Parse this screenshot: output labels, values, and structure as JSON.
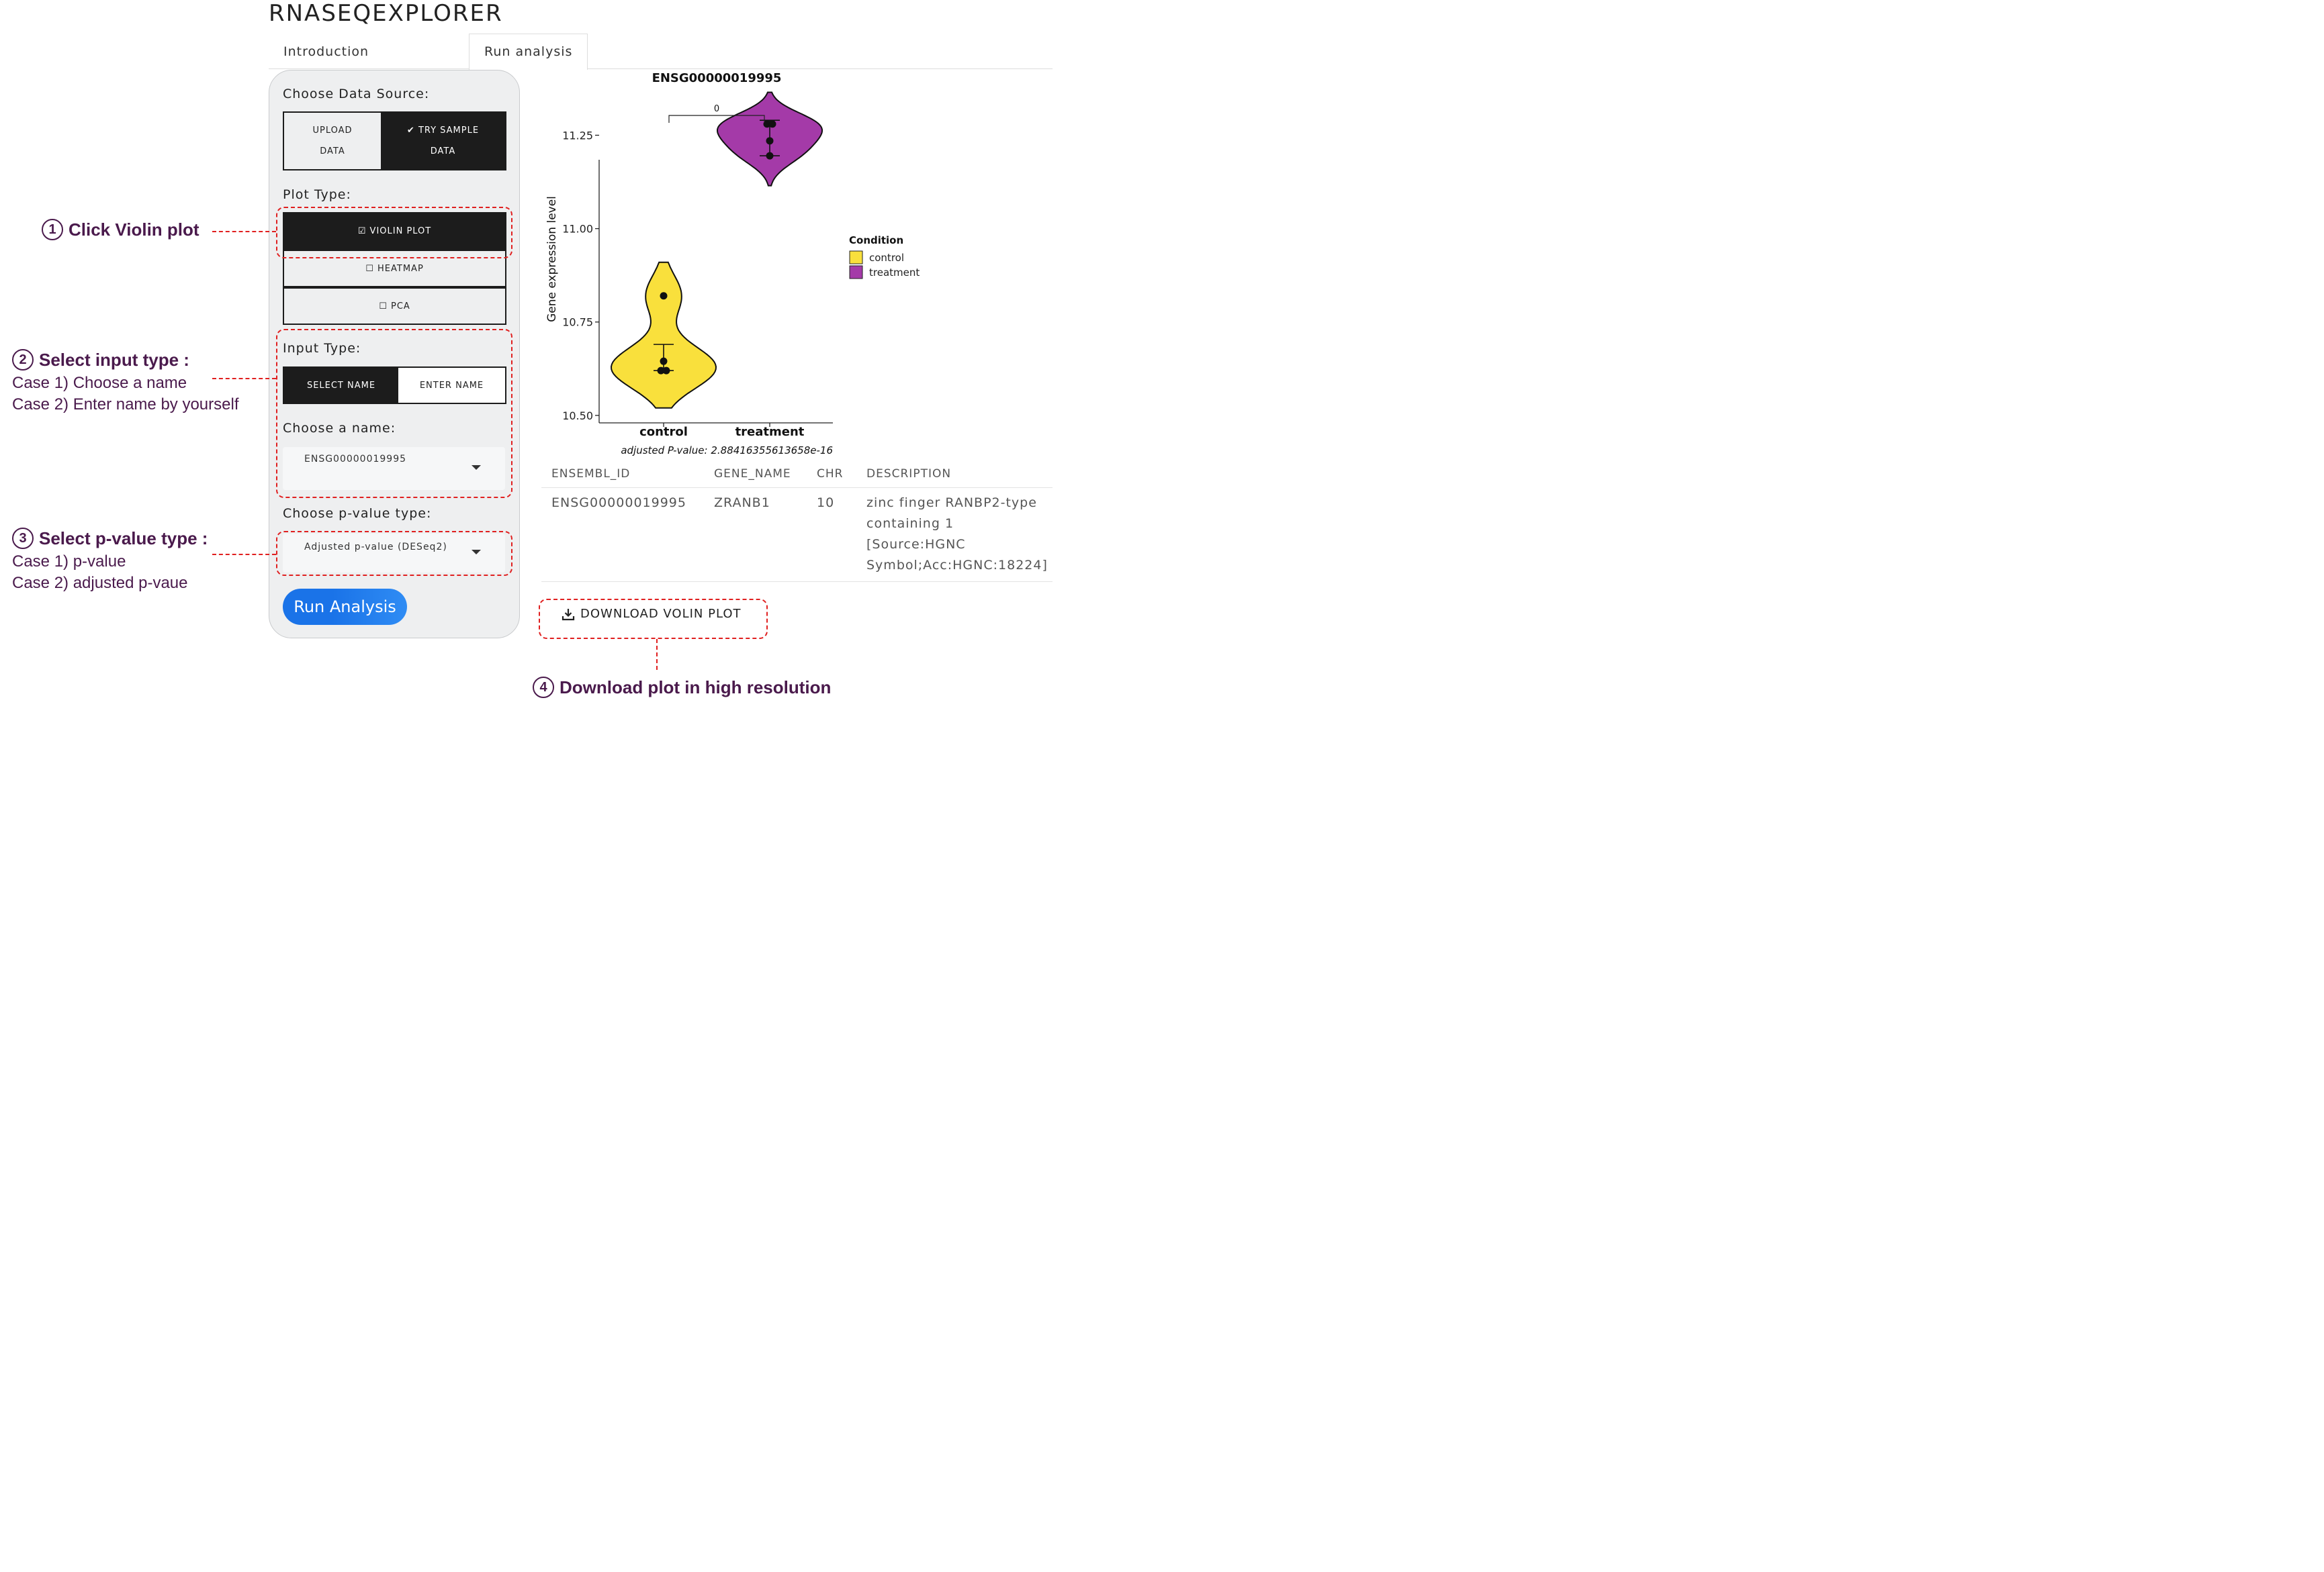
{
  "app": {
    "title": "RNASEQEXPLORER"
  },
  "tabs": [
    {
      "label": "Introduction",
      "active": false
    },
    {
      "label": "Run analysis",
      "active": true
    }
  ],
  "sidebar": {
    "data_source": {
      "label": "Choose Data Source:",
      "upload_line1": "UPLOAD",
      "upload_line2": "DATA",
      "sample_line1": "TRY SAMPLE",
      "sample_line2": "DATA",
      "selected": "sample"
    },
    "plot_type": {
      "label": "Plot Type:",
      "options": [
        "VIOLIN PLOT",
        "HEATMAP",
        "PCA"
      ],
      "selected": "VIOLIN PLOT"
    },
    "input_type": {
      "label": "Input Type:",
      "options": [
        "SELECT NAME",
        "ENTER NAME"
      ],
      "selected": "SELECT NAME"
    },
    "name_select": {
      "label": "Choose a name:",
      "value": "ENSG00000019995"
    },
    "pvalue_select": {
      "label": "Choose p-value type:",
      "value": "Adjusted p-value (DESeq2)"
    },
    "run_button": "Run Analysis"
  },
  "annotations": {
    "a1": {
      "num": "1",
      "title": "Click Violin plot"
    },
    "a2": {
      "num": "2",
      "title": "Select input type :",
      "line1": "Case 1) Choose a name",
      "line2": "Case 2) Enter name by yourself"
    },
    "a3": {
      "num": "3",
      "title": "Select p-value type :",
      "line1": "Case 1) p-value",
      "line2": "Case 2) adjusted p-vaue"
    },
    "a4": {
      "num": "4",
      "title": "Download plot in high resolution"
    }
  },
  "chart_data": {
    "type": "violin",
    "title": "ENSG00000019995",
    "ylabel": "Gene expression level",
    "xlabel": "",
    "categories": [
      "control",
      "treatment"
    ],
    "y_ticks": [
      10.5,
      10.75,
      11.0,
      11.25
    ],
    "y_tick_labels": [
      "10.50",
      "10.75",
      "11.00",
      "11.25"
    ],
    "ylim": [
      10.48,
      11.4
    ],
    "groups": [
      {
        "name": "control",
        "color": "#f9e03c",
        "points": [
          10.82,
          10.645,
          10.62,
          10.62
        ],
        "mean": 10.655,
        "err_low": 10.62,
        "err_high": 10.69,
        "vmin": 10.52,
        "vmax": 10.91
      },
      {
        "name": "treatment",
        "color": "#a43aa8",
        "points": [
          11.28,
          11.28,
          11.235,
          11.195
        ],
        "mean": 11.24,
        "err_low": 11.195,
        "err_high": 11.29,
        "vmin": 11.115,
        "vmax": 11.365
      }
    ],
    "significance_label": "0",
    "caption": "adjusted P-value: 2.88416355613658e-16",
    "legend": {
      "title": "Condition",
      "position": "right",
      "items": [
        "control",
        "treatment"
      ]
    },
    "grid": false
  },
  "gene_table": {
    "headers": [
      "ENSEMBL_ID",
      "GENE_NAME",
      "CHR",
      "DESCRIPTION"
    ],
    "row": {
      "id": "ENSG00000019995",
      "name": "ZRANB1",
      "chr": "10",
      "desc_lines": [
        "zinc finger RANBP2-type",
        "containing 1",
        "[Source:HGNC",
        "Symbol;Acc:HGNC:18224]"
      ]
    }
  },
  "download_button": "DOWNLOAD VOLIN PLOT",
  "colors": {
    "accent_blue": "#1a73e8",
    "annotation_red": "#e02020",
    "annotation_text": "#4a1a4c",
    "dark_button": "#1c1c1c"
  }
}
